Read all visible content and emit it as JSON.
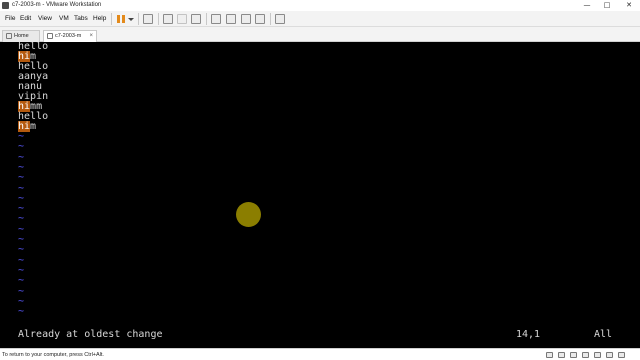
{
  "window": {
    "title": "c7-2003-m - VMware Workstation",
    "controls": [
      "—",
      "□",
      "✕"
    ]
  },
  "menu": [
    "File",
    "Edit",
    "View",
    "VM",
    "Tabs",
    "Help"
  ],
  "tabs": [
    {
      "label": "Home",
      "active": false
    },
    {
      "label": "c7-2003-m",
      "active": true
    }
  ],
  "tab_close_glyph": "×",
  "terminal": {
    "lines": [
      {
        "pre": "",
        "hl": "",
        "post": "hello"
      },
      {
        "pre": "",
        "hl": "hi",
        "post": "m"
      },
      {
        "pre": "",
        "hl": "",
        "post": "hello"
      },
      {
        "pre": "",
        "hl": "",
        "post": "aanya"
      },
      {
        "pre": "",
        "hl": "",
        "post": "nanu"
      },
      {
        "pre": "",
        "hl": "",
        "post": "vipin"
      },
      {
        "pre": "",
        "hl": "hi",
        "post": "mm"
      },
      {
        "pre": "",
        "hl": "",
        "post": "hello"
      },
      {
        "pre": "",
        "hl": "hi",
        "post": "m"
      }
    ],
    "tilde": "~",
    "status_message": "Already at oldest change",
    "cursor_position": "14,1",
    "scroll_indicator": "All"
  },
  "statusbar": {
    "hint": "To return to your computer, press Ctrl+Alt."
  },
  "colors": {
    "highlight": "#b55a0e",
    "tilde": "#5a5aff",
    "terminal_bg": "#000000",
    "pause_icon": "#e38a1b"
  }
}
